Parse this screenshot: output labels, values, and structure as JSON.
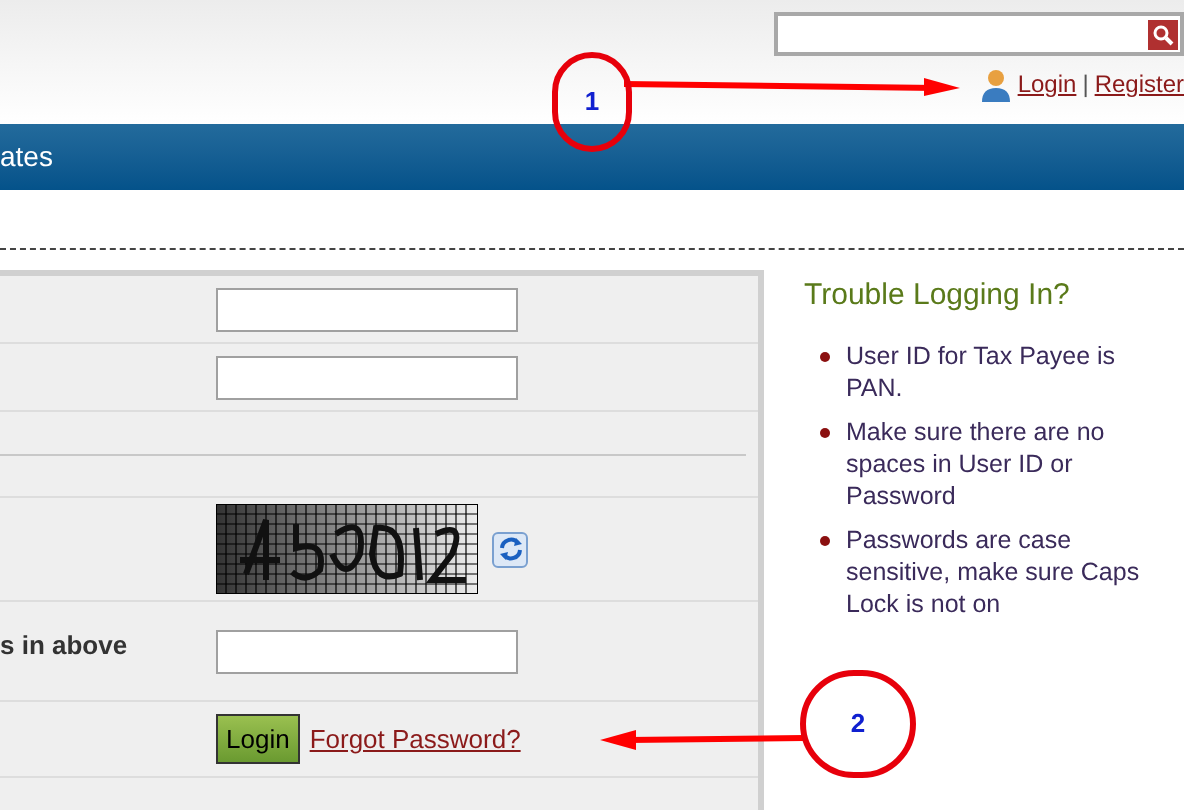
{
  "header": {
    "user_links": [
      "Login",
      "Register"
    ],
    "separator": "|"
  },
  "nav": {
    "item": "ates"
  },
  "form": {
    "captcha_label": "s in above",
    "login_button": "Login",
    "forgot_link": "Forgot Password?"
  },
  "help": {
    "title": "Trouble Logging In?",
    "tips": [
      "User ID for Tax Payee is PAN.",
      "Make sure there are no spaces in User ID or Password",
      "Passwords are case sensitive, make sure Caps Lock is not on"
    ]
  },
  "annotations": [
    {
      "label": "1"
    },
    {
      "label": "2"
    }
  ]
}
